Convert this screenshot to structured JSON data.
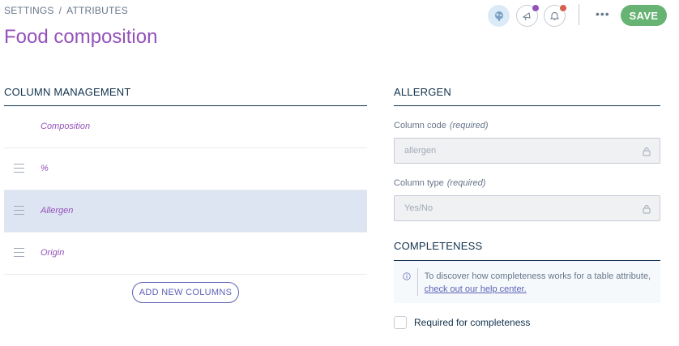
{
  "breadcrumb": {
    "items": [
      "SETTINGS",
      "ATTRIBUTES"
    ],
    "separator": "/"
  },
  "page": {
    "title": "Food composition"
  },
  "header": {
    "save_label": "SAVE",
    "more_label": "•••",
    "colors": {
      "save_bg": "#67b373",
      "title": "#9452ba",
      "announce_dot": "#9452ba",
      "notif_dot": "#d4604f"
    }
  },
  "column_management": {
    "title": "COLUMN MANAGEMENT",
    "columns": [
      {
        "label": "Composition",
        "draggable": false
      },
      {
        "label": "%",
        "draggable": true
      },
      {
        "label": "Allergen",
        "draggable": true,
        "selected": true
      },
      {
        "label": "Origin",
        "draggable": true
      }
    ],
    "add_button_label": "ADD NEW COLUMNS"
  },
  "allergen_panel": {
    "title": "ALLERGEN",
    "column_code": {
      "label": "Column code",
      "required_note": "(required)",
      "value": "allergen"
    },
    "column_type": {
      "label": "Column type",
      "required_note": "(required)",
      "value": "Yes/No"
    }
  },
  "completeness": {
    "title": "COMPLETENESS",
    "info_text": "To discover how completeness works for a table attribute,",
    "info_link": "check out our help center.",
    "checkbox_label": "Required for completeness",
    "checked": false
  }
}
